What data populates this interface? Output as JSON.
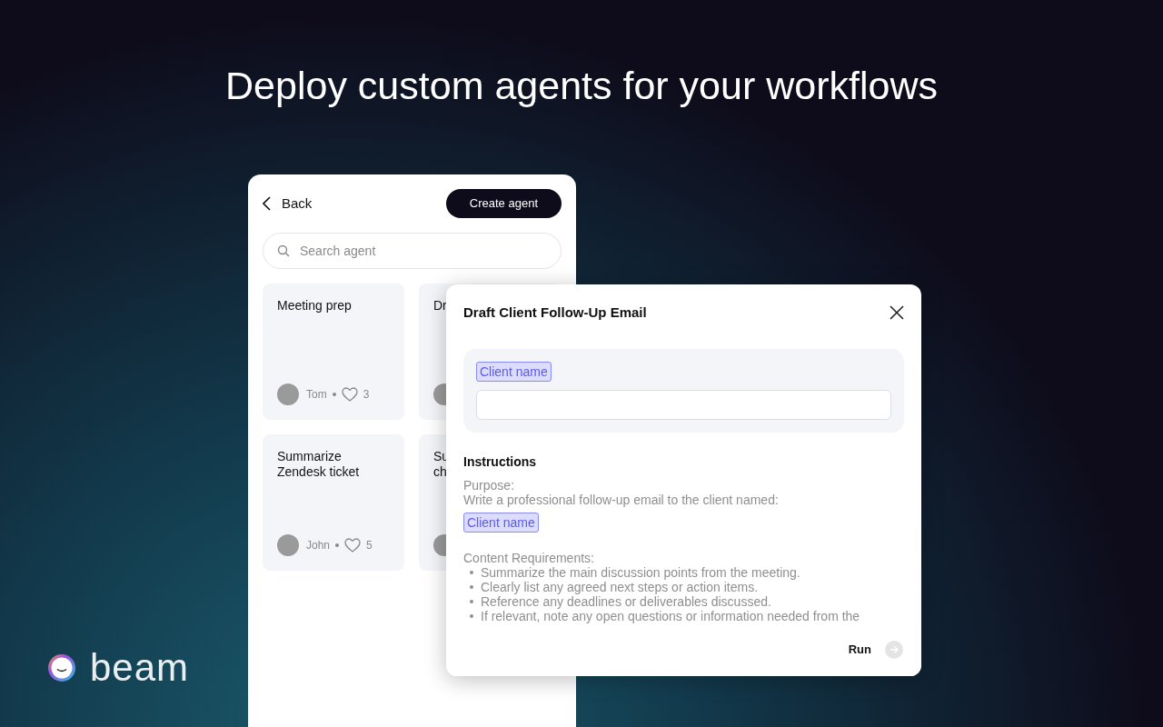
{
  "headline": "Deploy custom agents for your workflows",
  "panel": {
    "back_label": "Back",
    "create_button": "Create agent",
    "search": {
      "placeholder": "Search agent"
    },
    "cards": [
      {
        "title": "Meeting prep",
        "author": "Tom",
        "likes": "3"
      },
      {
        "title": "Dr"
      },
      {
        "title": "Summarize Zendesk ticket",
        "author": "John",
        "likes": "5"
      },
      {
        "title": "Su\nch"
      }
    ]
  },
  "modal": {
    "title": "Draft Client Follow-Up Email",
    "field": {
      "label": "Client name"
    },
    "instructions_heading": "Instructions",
    "purpose_label": "Purpose:",
    "purpose_text": "Write a professional follow-up email to the client named:",
    "purpose_tag": "Client name",
    "requirements_label": "Content Requirements:",
    "requirements": [
      "Summarize the main discussion points from the meeting.",
      "Clearly list any agreed next steps or action items.",
      "Reference any deadlines or deliverables discussed.",
      "If relevant, note any open questions or information needed from the"
    ],
    "run_label": "Run"
  },
  "logo_text": "beam"
}
